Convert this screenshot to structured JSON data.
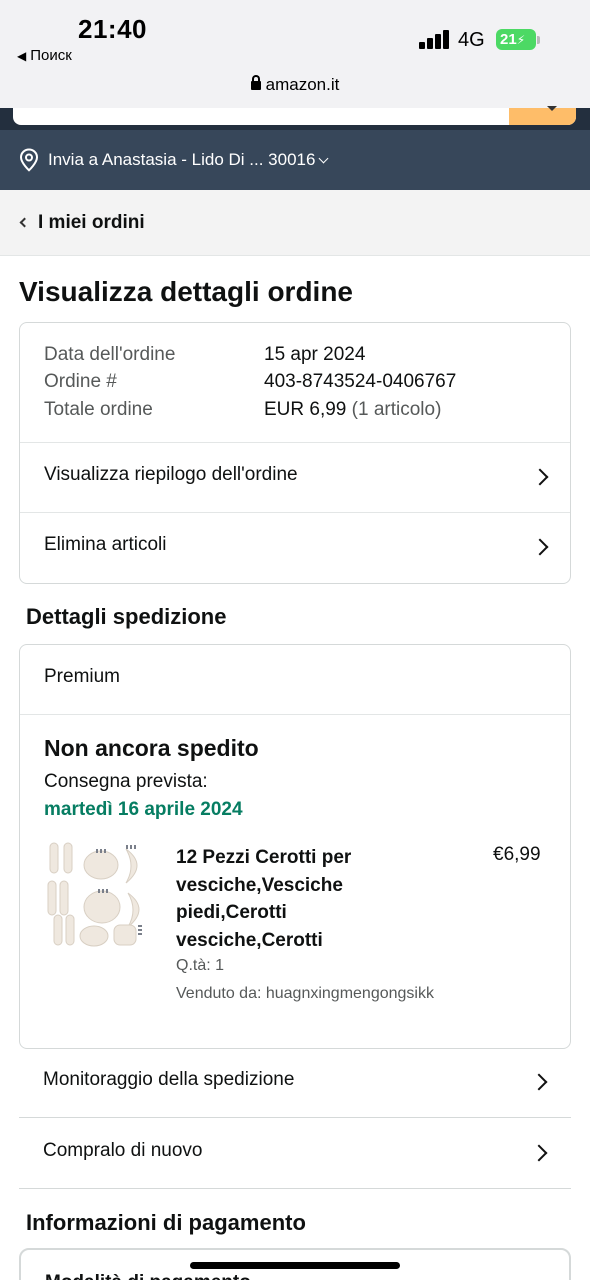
{
  "status_bar": {
    "time": "21:40",
    "back_app": "Поиск",
    "network": "4G",
    "battery": "21"
  },
  "browser": {
    "url": "amazon.it"
  },
  "header": {
    "deliver_to": "Invia a Anastasia - Lido Di ... 30016"
  },
  "breadcrumb": {
    "label": "I miei ordini"
  },
  "page": {
    "title": "Visualizza dettagli ordine"
  },
  "order": {
    "date_label": "Data dell'ordine",
    "date_value": "15 apr 2024",
    "number_label": "Ordine #",
    "number_value": "403-8743524-0406767",
    "total_label": "Totale ordine",
    "total_value": "EUR 6,99",
    "total_items": "(1 articolo)",
    "summary_link": "Visualizza riepilogo dell'ordine",
    "delete_link": "Elimina articoli"
  },
  "shipping": {
    "section_title": "Dettagli spedizione",
    "type": "Premium",
    "status": "Non ancora spedito",
    "eta_label": "Consegna prevista:",
    "eta_date": "martedì 16 aprile 2024",
    "item": {
      "title": "12 Pezzi Cerotti per vesciche,Vesciche piedi,Cerotti vesciche,Cerotti",
      "price": "€6,99",
      "qty": "Q.tà: 1",
      "seller": "Venduto da: huagnxingmengongsikk"
    },
    "track_link": "Monitoraggio della spedizione",
    "buy_again_link": "Compralo di nuovo"
  },
  "payment": {
    "section_title": "Informazioni di pagamento",
    "method_label": "Modalità di pagamento"
  },
  "colors": {
    "header_dark": "#232f3e",
    "deliver_bar": "#37475a",
    "search_button": "#febd69",
    "eta_green": "#067d62"
  }
}
